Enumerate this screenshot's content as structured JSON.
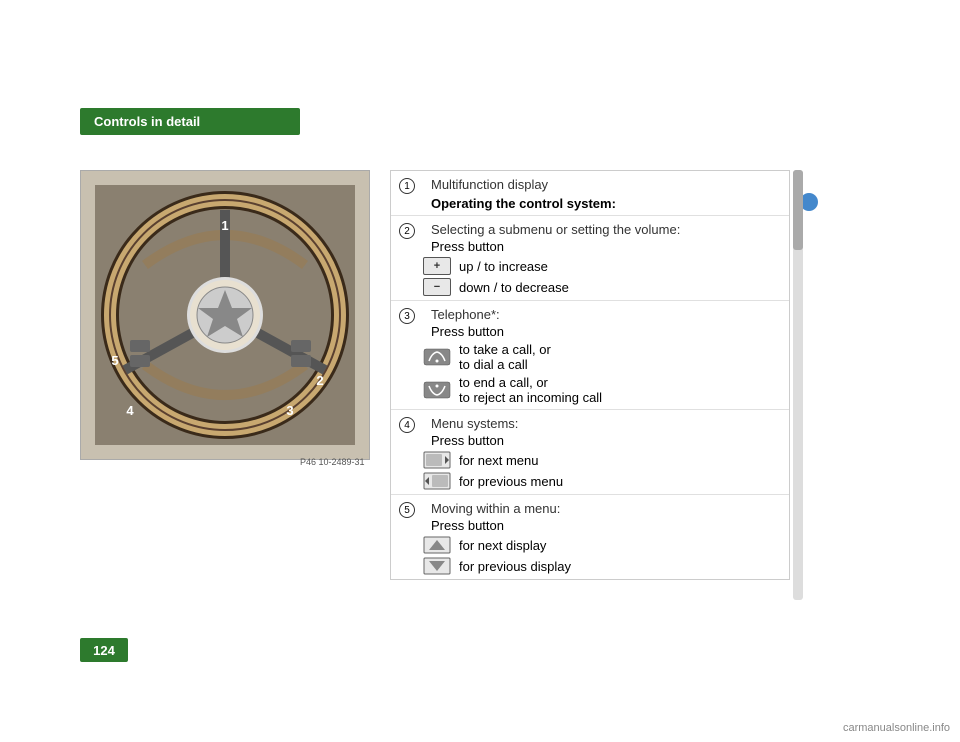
{
  "header": {
    "title": "Controls in detail"
  },
  "page_number": "124",
  "photo_label": "P46 10-2489-31",
  "blue_dot_color": "#4488cc",
  "panel": {
    "sections": [
      {
        "id": 1,
        "title": "Multifunction display",
        "bold": false,
        "sub_title": "Operating the control system:",
        "items": []
      },
      {
        "id": 2,
        "title": "Selecting a submenu or setting the volume:",
        "press_label": "Press button",
        "buttons": [
          {
            "icon_type": "plus",
            "label": "up / to increase"
          },
          {
            "icon_type": "minus",
            "label": "down / to decrease"
          }
        ]
      },
      {
        "id": 3,
        "title": "Telephone*:",
        "press_label": "Press button",
        "buttons": [
          {
            "icon_type": "phone-answer",
            "label": "to take a call, or\nto dial a call"
          },
          {
            "icon_type": "phone-reject",
            "label": "to end a call, or\nto reject an incoming call"
          }
        ]
      },
      {
        "id": 4,
        "title": "Menu systems:",
        "press_label": "Press button",
        "buttons": [
          {
            "icon_type": "menu-next",
            "label": "for next menu"
          },
          {
            "icon_type": "menu-prev",
            "label": "for previous menu"
          }
        ]
      },
      {
        "id": 5,
        "title": "Moving within a menu:",
        "press_label": "Press button",
        "buttons": [
          {
            "icon_type": "arrow-up",
            "label": "for next display"
          },
          {
            "icon_type": "arrow-down",
            "label": "for previous display"
          }
        ]
      }
    ]
  },
  "watermark": "carmanualsonline.info"
}
